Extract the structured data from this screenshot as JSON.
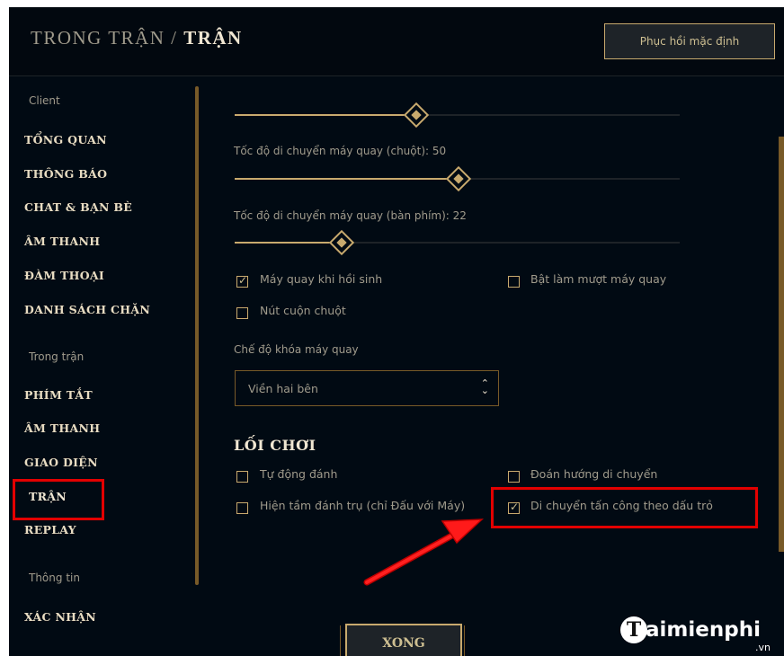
{
  "header": {
    "title_prefix": "TRONG TRẬN /",
    "title_current": "TRẬN",
    "reset_button": "Phục hồi mặc định"
  },
  "sidebar": {
    "client_header": "Client",
    "client_items": [
      "TỔNG QUAN",
      "THÔNG BÁO",
      "CHAT & BẠN BÈ",
      "ÂM THANH",
      "ĐÀM THOẠI",
      "DANH SÁCH CHẶN"
    ],
    "ingame_header": "Trong trận",
    "ingame_items": [
      "PHÍM TẮT",
      "ÂM THANH",
      "GIAO DIỆN",
      "TRẬN",
      "REPLAY"
    ],
    "info_header": "Thông tin",
    "info_items": [
      "XÁC NHẬN"
    ],
    "active_item": "TRẬN"
  },
  "camera": {
    "mouse_speed_label": "Tốc độ di chuyển máy quay (chuột): 50",
    "mouse_speed": 50,
    "keyboard_speed_label": "Tốc độ di chuyển máy quay (bàn phím): 22",
    "keyboard_speed": 22,
    "checkboxes": [
      {
        "label": "Máy quay khi hồi sinh",
        "checked": true
      },
      {
        "label": "Bật làm mượt máy quay",
        "checked": false
      },
      {
        "label": "Nút cuộn chuột",
        "checked": false
      }
    ],
    "lock_mode_label": "Chế độ khóa máy quay",
    "lock_mode_value": "Viền hai bên"
  },
  "gameplay": {
    "section_title": "LỐI CHƠI",
    "checkboxes": [
      {
        "label": "Tự động đánh",
        "checked": false
      },
      {
        "label": "Đoán hướng di chuyển",
        "checked": false
      },
      {
        "label": "Hiện tầm đánh trụ (chỉ Đấu với Máy)",
        "checked": false
      },
      {
        "label": "Di chuyển tấn công theo dấu trỏ",
        "checked": true
      }
    ]
  },
  "footer": {
    "done_button": "XONG"
  },
  "watermark": {
    "logo_letter": "T",
    "text": "aimienphi",
    "suffix": ".vn"
  },
  "colors": {
    "gold": "#c8aa6e",
    "dark_gold": "#785a28",
    "background": "#010a13",
    "highlight": "#e30000",
    "text": "#a09b8c"
  },
  "icons": {
    "check": "check-icon",
    "select_arrows": "up-down-chevron-icon",
    "slider_thumb": "diamond-thumb-icon"
  }
}
